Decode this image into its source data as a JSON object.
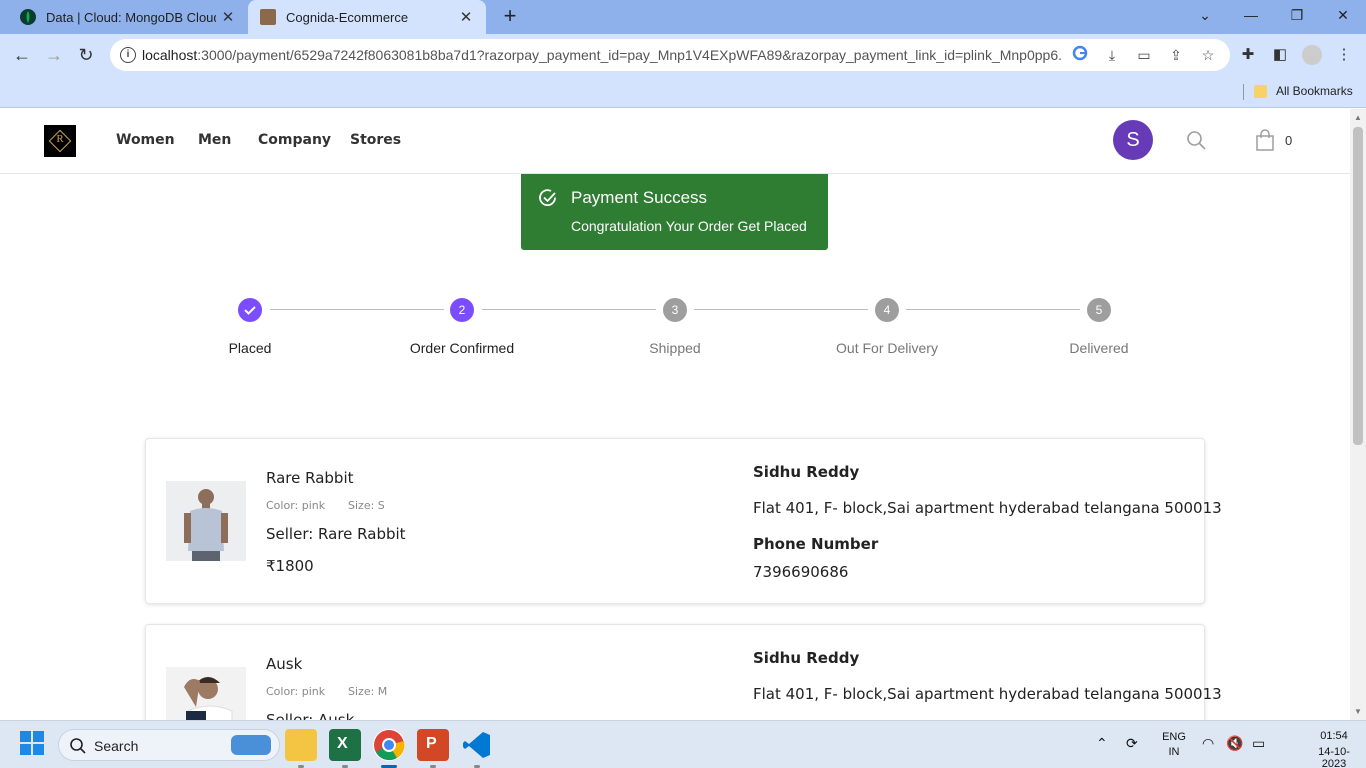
{
  "browser": {
    "tabs": [
      {
        "title": "Data | Cloud: MongoDB Cloud",
        "active": false
      },
      {
        "title": "Cognida-Ecommerce",
        "active": true
      }
    ],
    "url_host": "localhost",
    "url_rest": ":3000/payment/6529a7242f8063081b8ba7d1?razorpay_payment_id=pay_Mnp1V4EXpWFA89&razorpay_payment_link_id=plink_Mnp0pp6...",
    "bookmarks_label": "All Bookmarks"
  },
  "header": {
    "logo_letter": "R",
    "nav": [
      "Women",
      "Men",
      "Company",
      "Stores"
    ],
    "avatar_letter": "S",
    "cart_count": "0"
  },
  "toast": {
    "title": "Payment Success",
    "message": "Congratulation Your Order Get Placed"
  },
  "stepper": {
    "steps": [
      {
        "number": "1",
        "label": "Placed",
        "state": "done"
      },
      {
        "number": "2",
        "label": "Order Confirmed",
        "state": "active"
      },
      {
        "number": "3",
        "label": "Shipped",
        "state": "pending"
      },
      {
        "number": "4",
        "label": "Out For Delivery",
        "state": "pending"
      },
      {
        "number": "5",
        "label": "Delivered",
        "state": "pending"
      }
    ]
  },
  "orders": [
    {
      "name": "Rare Rabbit",
      "color": "Color: pink",
      "size": "Size: S",
      "seller": "Seller: Rare Rabbit",
      "price": "₹1800",
      "customer": "Sidhu Reddy",
      "address": "Flat 401, F- block,Sai apartment hyderabad telangana 500013",
      "phone_label": "Phone Number",
      "phone": "7396690686"
    },
    {
      "name": "Ausk",
      "color": "Color: pink",
      "size": "Size: M",
      "seller": "Seller: Ausk",
      "customer": "Sidhu Reddy",
      "address": "Flat 401, F- block,Sai apartment hyderabad telangana 500013"
    }
  ],
  "taskbar": {
    "search_label": "Search",
    "lang_top": "ENG",
    "lang_bottom": "IN",
    "time": "01:54",
    "date": "14-10-2023"
  },
  "colors": {
    "accent_purple": "#7c4dff",
    "toast_green": "#2e7d32",
    "avatar_purple": "#673ab7",
    "pending_grey": "#9e9e9e"
  }
}
